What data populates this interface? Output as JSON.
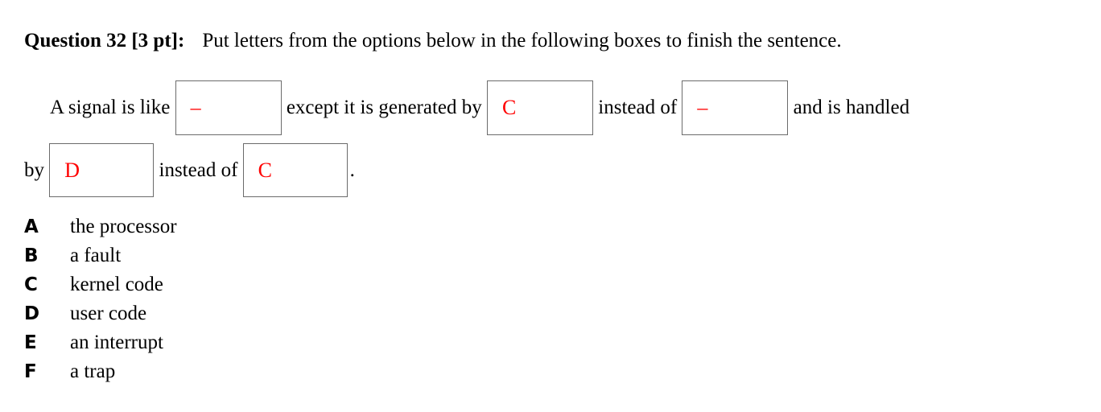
{
  "question": {
    "label": "Question 32 [3 pt]:",
    "body": "Put letters from the options below in the following boxes to finish the sentence."
  },
  "sentence": {
    "seg1": "A signal is like",
    "box1": {
      "value": "–",
      "name": "answer-box-1"
    },
    "seg2": "except it is generated by",
    "box2": {
      "value": "C",
      "name": "answer-box-2"
    },
    "seg3": "instead of",
    "box3": {
      "value": "–",
      "name": "answer-box-3"
    },
    "seg4": "and is handled",
    "seg5": "by",
    "box4": {
      "value": "D",
      "name": "answer-box-4"
    },
    "seg6": "instead of",
    "box5": {
      "value": "C",
      "name": "answer-box-5"
    },
    "seg7": "."
  },
  "options": [
    {
      "key": "A",
      "text": "the processor"
    },
    {
      "key": "B",
      "text": "a fault"
    },
    {
      "key": "C",
      "text": "kernel code"
    },
    {
      "key": "D",
      "text": "user code"
    },
    {
      "key": "E",
      "text": "an interrupt"
    },
    {
      "key": "F",
      "text": "a trap"
    }
  ],
  "colors": {
    "answer_ink": "#ff0000",
    "box_border": "#6b6b6b",
    "text": "#000000",
    "background": "#ffffff"
  }
}
